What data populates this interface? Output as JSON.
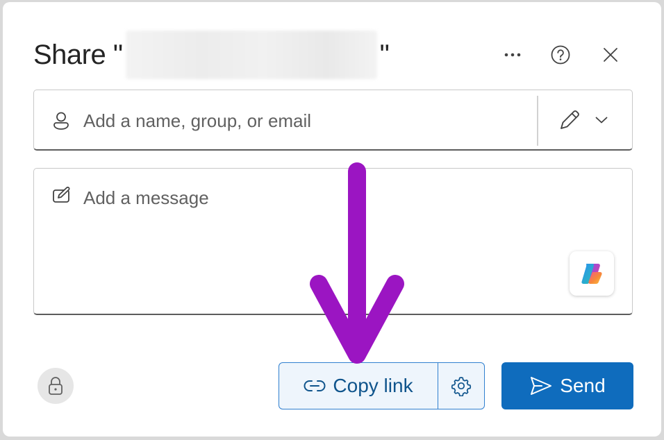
{
  "dialog": {
    "title_prefix": "Share \"",
    "title_name": "(blurred file name)",
    "title_suffix": "\""
  },
  "header_icons": [
    "more-options-icon",
    "help-icon",
    "close-icon"
  ],
  "recipients": {
    "placeholder": "Add a name, group, or email",
    "permission_icon": "pencil-icon"
  },
  "message": {
    "placeholder": "Add a message"
  },
  "footer": {
    "copy_link_label": "Copy link",
    "send_label": "Send"
  },
  "colors": {
    "accent": "#0f6cbd",
    "copy_link_bg": "#eef5fc",
    "annotation_arrow": "#9b15c2"
  }
}
